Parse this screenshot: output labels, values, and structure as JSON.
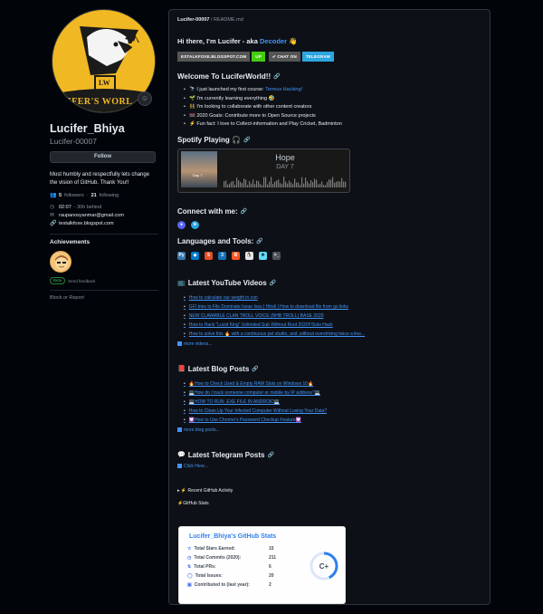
{
  "profile": {
    "display_name": "Lucifer_Bhiya",
    "username": "Lucifer-00007",
    "follow_label": "Follow",
    "avatar_text": "LW",
    "avatar_banner": "CIFER'S WORL",
    "bio": "Most humbly and respectfully lets change the vision of GitHub. Thank You!!",
    "followers_count": "5",
    "followers_label": "followers",
    "following_count": "21",
    "following_label": "following",
    "time": "02:07",
    "time_note": "- 30h behind",
    "email": "raupanosyanmar@gmail.com",
    "website": "testalkfoxe.blogspot.com",
    "achievements_title": "Achievements",
    "beta_label": "Beta",
    "beta_text": "Send feedback",
    "block_label": "Block or Report"
  },
  "readme": {
    "path_user": "Lucifer-00007",
    "path_file": " / README.md",
    "intro_text": "Hi there, I'm Lucifer - aka ",
    "intro_link": "Decoder",
    "intro_emoji": "👋",
    "shields": [
      {
        "label": "ESTALKFOXE.BLOGSPOT.COM",
        "color": "#555555"
      },
      {
        "label": "UP",
        "color": "#44cc11"
      },
      {
        "label": "✔ CHAT ON",
        "color": "#555555"
      },
      {
        "label": "TELEGRAM",
        "color": "#2ca5e0"
      }
    ],
    "welcome_title": "Welcome To LuciferWorld!!",
    "bullets": [
      {
        "text": "🔭 I just launched my first course: ",
        "link": "Termux Hacking!"
      },
      {
        "text": "🌱 I'm currently learning everything 🤣",
        "link": ""
      },
      {
        "text": "👯 I'm looking to collaborate with other content creators",
        "link": ""
      },
      {
        "text": "🥅 2020 Goals: Contribute more to Open Source projects",
        "link": ""
      },
      {
        "text": "⚡ Fun fact: I love to Collect-information and Play Cricket, Badminton",
        "link": ""
      }
    ],
    "spotify_title": "Spotify Playing 🎧",
    "spotify_song": "Hope",
    "spotify_artist": "DAY 7",
    "spotify_cover_caption": "Day 7",
    "connect_title": "Connect with me:",
    "tools_title": "Languages and Tools:",
    "tools": [
      {
        "name": "python",
        "color": "#3776ab",
        "glyph": "Py"
      },
      {
        "name": "vscode",
        "color": "#007acc",
        "glyph": "◆"
      },
      {
        "name": "html5",
        "color": "#e34f26",
        "glyph": "5"
      },
      {
        "name": "css3",
        "color": "#1572b6",
        "glyph": "3"
      },
      {
        "name": "blogger",
        "color": "#ff5722",
        "glyph": "B"
      },
      {
        "name": "linux",
        "color": "#e6e6e6",
        "glyph": "🐧"
      },
      {
        "name": "react",
        "color": "#61dafb",
        "glyph": "⚛"
      },
      {
        "name": "bash",
        "color": "#4e5256",
        "glyph": ">_"
      }
    ],
    "youtube_title": "Latest YouTube Videos",
    "youtube_links": [
      "How to calculate our weight in con",
      "GFI tries to File Dominate Issue Issu | Hindi | How to download file from go links",
      "NEW CLAWABLE CLAN TROLL VOICE (NHB TROLL) BASE 2020",
      "How to Hack \"Lucid King\" Unlimited Sub Without Root 2020!!!Solo Hack",
      "How to solve this 🔥 with a continuous pet studio, and ,without overdriving twice a line..."
    ],
    "youtube_more": "more videos...",
    "blog_title": "Latest Blog Posts",
    "blog_links": [
      "🔥How to Check Used & Empty RAM Slots on Windows 10🔥",
      "💻How do I track someone computer or mobile by IP address?💻",
      "💻HOW TO RUN .EXE FILE IN ANDROID💻",
      "How to Clean Up Your Infected Computer Without Losing Your Data?",
      "💟How to Use Chrome's Password Checkup Feature💟"
    ],
    "blog_more": "more blog posts...",
    "telegram_title": "Latest Telegram Posts",
    "telegram_link": "Click Here...",
    "activity_summary": "▸ ⚡ Recent GitHub Activity",
    "stats_label": "⚡GitHub Stats",
    "stats_card": {
      "title": "Lucifer_Bhiya's GitHub Stats",
      "rows": [
        {
          "label": "Total Stars Earned:",
          "value": "15"
        },
        {
          "label": "Total Commits (2020):",
          "value": "211"
        },
        {
          "label": "Total PRs:",
          "value": "6"
        },
        {
          "label": "Total Issues:",
          "value": "20"
        },
        {
          "label": "Contributed to (last year):",
          "value": "2"
        }
      ],
      "grade": "C+",
      "ring_color": "#2f80ed"
    }
  }
}
